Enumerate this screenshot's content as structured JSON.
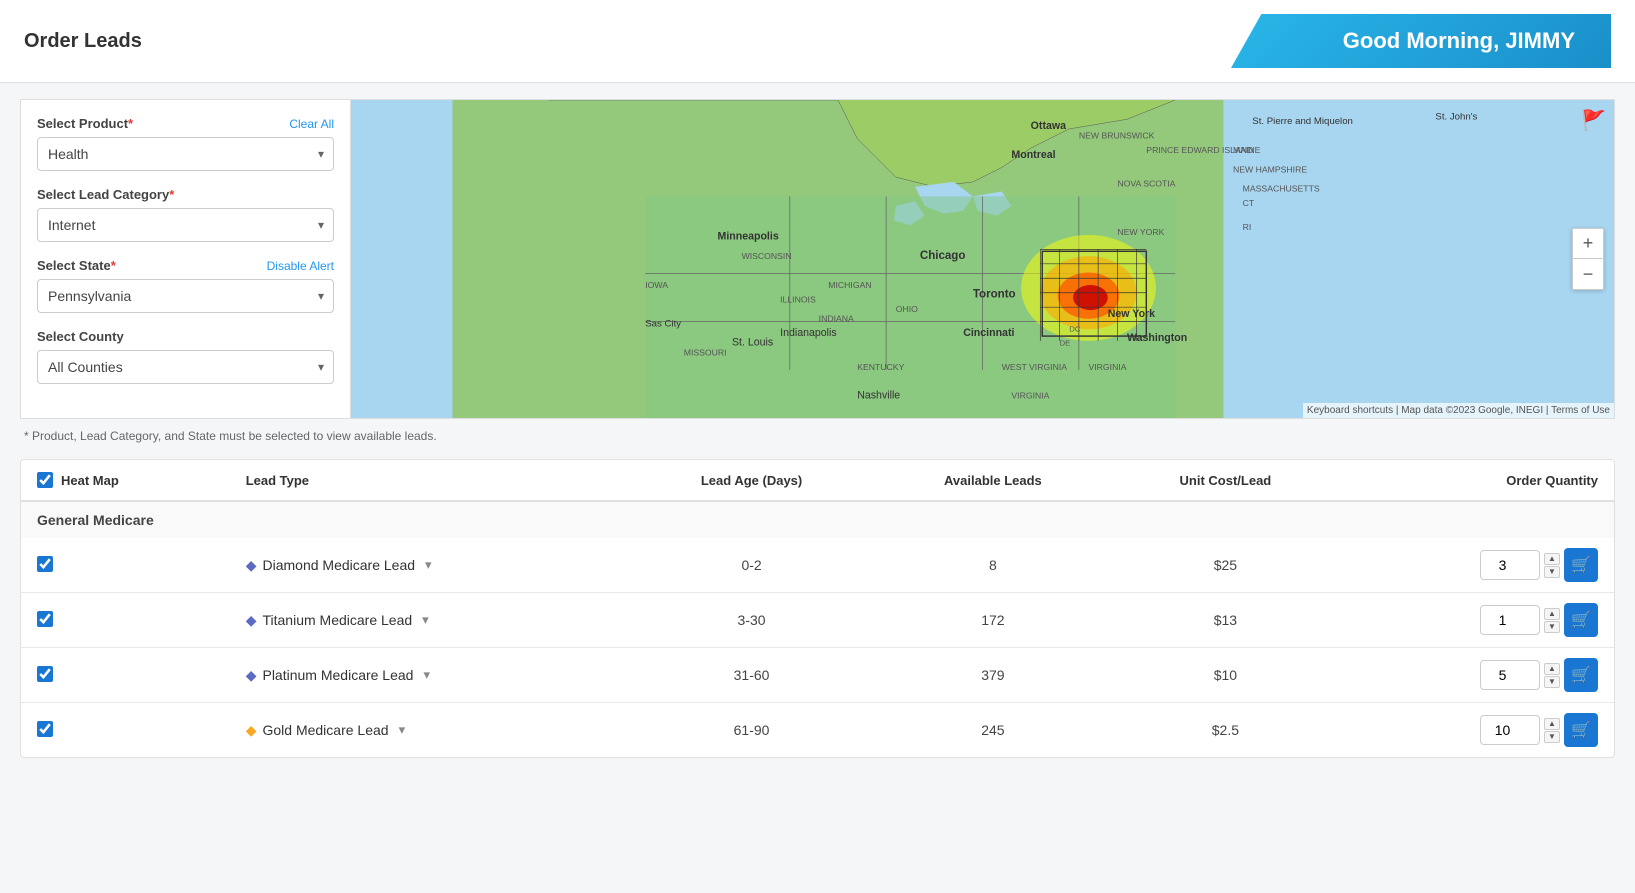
{
  "header": {
    "title": "Order Leads",
    "greeting": "Good Morning, JIMMY"
  },
  "sidebar": {
    "select_product_label": "Select Product",
    "clear_all_label": "Clear All",
    "product_value": "Health",
    "select_lead_category_label": "Select Lead Category",
    "lead_category_value": "Internet",
    "select_state_label": "Select State",
    "disable_alert_label": "Disable Alert",
    "state_value": "Pennsylvania",
    "select_county_label": "Select County",
    "county_value": "All Counties"
  },
  "note": "* Product, Lead Category, and State must be selected to view available leads.",
  "table": {
    "columns": {
      "heatmap": "Heat Map",
      "lead_type": "Lead Type",
      "lead_age": "Lead Age (Days)",
      "available_leads": "Available Leads",
      "unit_cost": "Unit Cost/Lead",
      "order_qty": "Order Quantity"
    },
    "sections": [
      {
        "section_name": "General Medicare",
        "rows": [
          {
            "id": "diamond",
            "icon_type": "diamond",
            "lead_type": "Diamond Medicare Lead",
            "lead_age": "0-2",
            "available_leads": "8",
            "unit_cost": "$25",
            "order_qty": "3"
          },
          {
            "id": "titanium",
            "icon_type": "diamond",
            "lead_type": "Titanium Medicare Lead",
            "lead_age": "3-30",
            "available_leads": "172",
            "unit_cost": "$13",
            "order_qty": "1"
          },
          {
            "id": "platinum",
            "icon_type": "diamond",
            "lead_type": "Platinum Medicare Lead",
            "lead_age": "31-60",
            "available_leads": "379",
            "unit_cost": "$10",
            "order_qty": "5"
          },
          {
            "id": "gold",
            "icon_type": "gold",
            "lead_type": "Gold Medicare Lead",
            "lead_age": "61-90",
            "available_leads": "245",
            "unit_cost": "$2.5",
            "order_qty": "10"
          }
        ]
      }
    ]
  },
  "map": {
    "attribution": "Keyboard shortcuts | Map data ©2023 Google, INEGI | Terms of Use",
    "zoom_in": "+",
    "zoom_out": "−"
  }
}
